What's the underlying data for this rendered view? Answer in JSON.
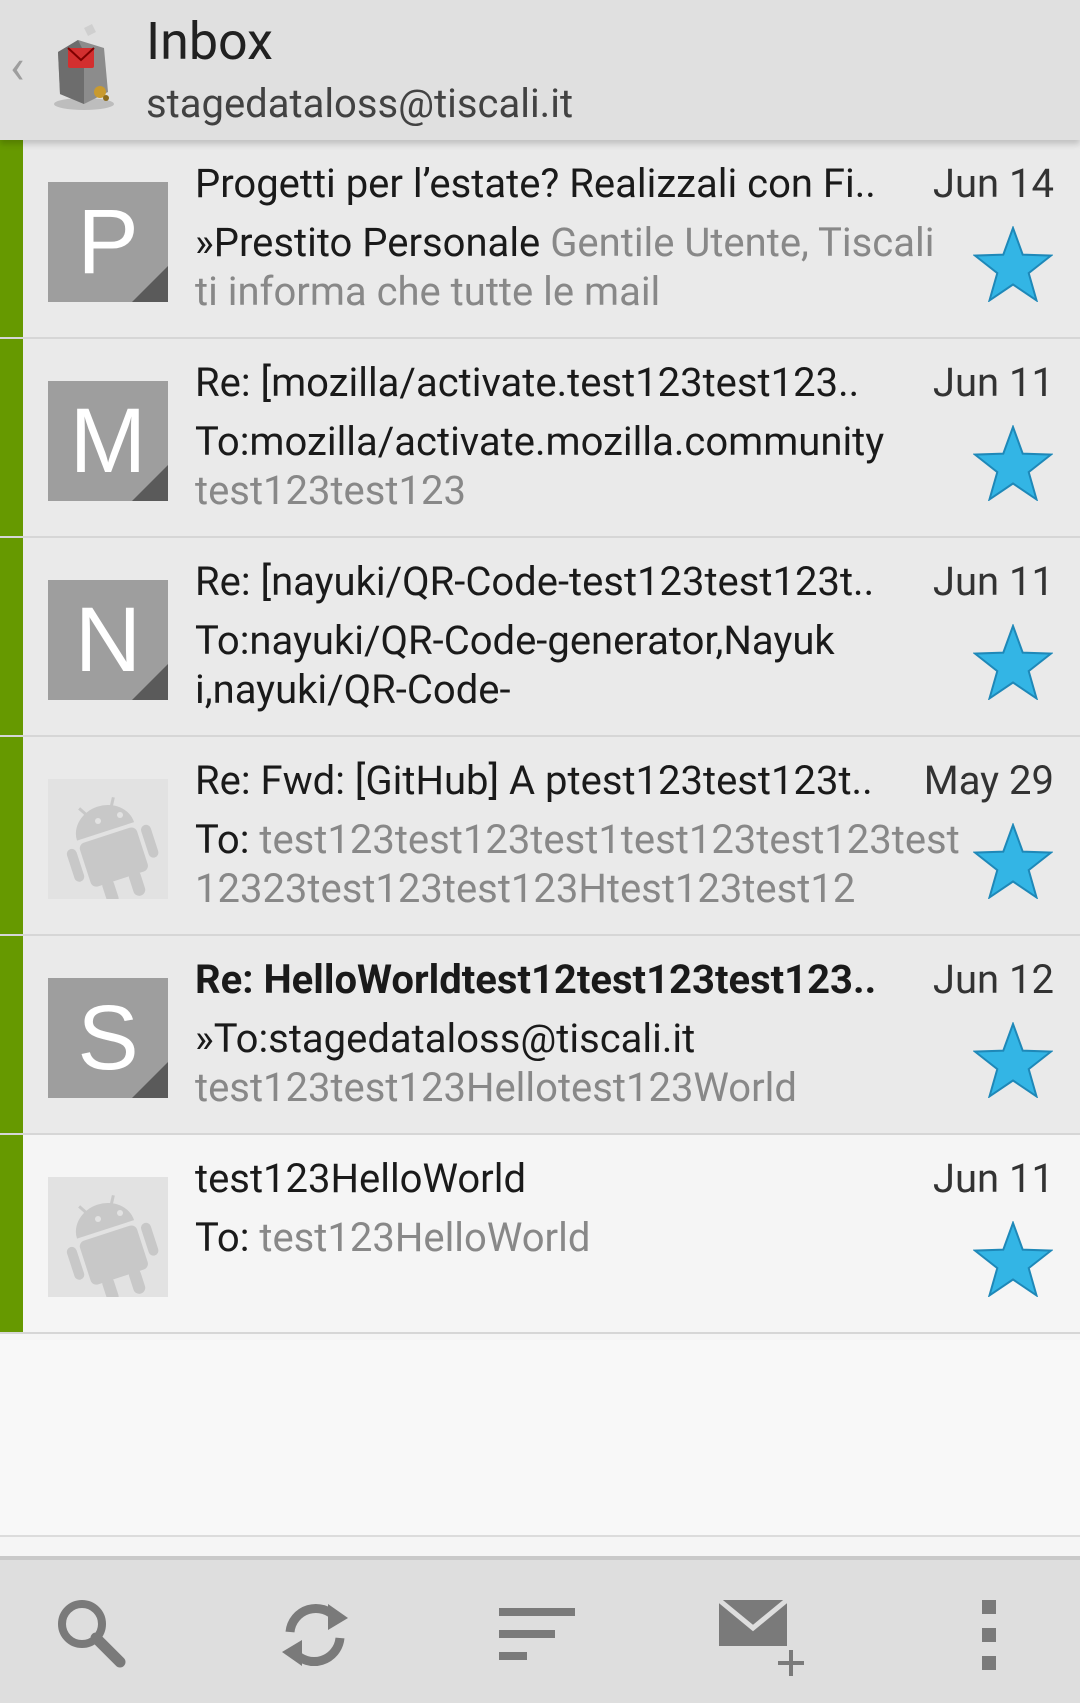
{
  "header": {
    "title": "Inbox",
    "account": "stagedataloss@tiscali.it"
  },
  "messages": [
    {
      "avatar_letter": "P",
      "subject": "Progetti per l’estate? Realizzali con Fi..",
      "date": "Jun 14",
      "sender": "»Prestito Personale",
      "preview": "Gentile Utente, Tiscali ti informa che tutte le mail",
      "starred": true,
      "unread": false
    },
    {
      "avatar_letter": "M",
      "subject": "Re: [mozilla/activate.test123test123..",
      "date": "Jun 11",
      "sender": "To:mozilla/activate.mozilla.community",
      "preview": "test123test123",
      "starred": true,
      "unread": false
    },
    {
      "avatar_letter": "N",
      "subject": "Re: [nayuki/QR-Code-test123test123t..",
      "date": "Jun 11",
      "sender": "To:nayuki/QR-Code-generator,Nayuki,nayuki/QR-Code-",
      "preview": "",
      "starred": true,
      "unread": false
    },
    {
      "avatar_letter": "",
      "subject": "Re: Fwd: [GitHub] A ptest123test123t..",
      "date": "May 29",
      "sender": "To:",
      "preview": "test123test123test1test123test123test12323test123test123Htest123test12",
      "starred": true,
      "unread": false
    },
    {
      "avatar_letter": "S",
      "subject": "Re: HelloWorldtest12test123test123..",
      "date": "Jun 12",
      "sender": "»To:stagedataloss@tiscali.it",
      "preview": "test123test123Hellotest123World",
      "starred": true,
      "unread": true
    },
    {
      "avatar_letter": "",
      "subject": "test123HelloWorld",
      "date": "Jun 11",
      "sender": "To:",
      "preview": "test123HelloWorld",
      "starred": true,
      "unread": false
    }
  ],
  "bottom_bar": {
    "buttons": [
      "search-icon",
      "refresh-icon",
      "sort-icon",
      "compose-icon",
      "overflow-menu-icon"
    ]
  },
  "colors": {
    "chip": "#669900",
    "star": "#33b5e5",
    "actionbar": "#e0e0e0"
  }
}
